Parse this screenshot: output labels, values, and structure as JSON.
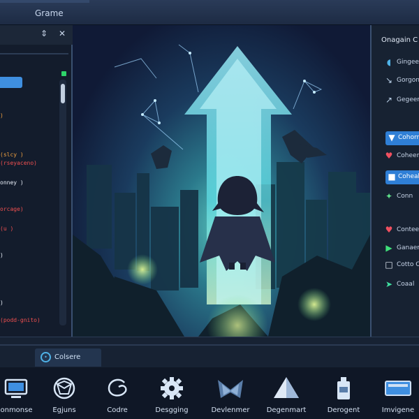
{
  "window": {
    "title": "Grame"
  },
  "left_panel": {
    "code_lines": [
      {
        "text": ")",
        "color": "orange"
      },
      {
        "text": "(slcy )",
        "color": "orange"
      },
      {
        "text": "(rseyaceno)",
        "color": "red"
      },
      {
        "text": "onney )",
        "color": "white"
      },
      {
        "text": "orcage)",
        "color": "red"
      },
      {
        "text": "(u )",
        "color": "red"
      },
      {
        "text": ")",
        "color": "white"
      },
      {
        "text": ")",
        "color": "white"
      },
      {
        "text": "(podd-gnito)",
        "color": "red"
      }
    ]
  },
  "right_panel": {
    "title": "Onagain C",
    "items": [
      {
        "label": "Gingeed",
        "icon": "cursor-icon",
        "selected": false
      },
      {
        "label": "Gorgon",
        "icon": "arrow-icon",
        "selected": false
      },
      {
        "label": "Gegeer",
        "icon": "arrow-icon",
        "selected": false
      },
      {
        "label": "Cohorn",
        "icon": "shield-icon",
        "selected": true
      },
      {
        "label": "Coheen",
        "icon": "heart-icon",
        "selected": false
      },
      {
        "label": "Coheab",
        "icon": "puzzle-icon",
        "selected": true
      },
      {
        "label": "Conn",
        "icon": "star-icon",
        "selected": false
      },
      {
        "label": "Conteel",
        "icon": "heart-icon",
        "selected": false
      },
      {
        "label": "Ganaer",
        "icon": "play-icon",
        "selected": false
      },
      {
        "label": "Cotto Co",
        "icon": "square-icon",
        "selected": false
      },
      {
        "label": "Coaal",
        "icon": "play-icon",
        "selected": false
      }
    ]
  },
  "console_tab": {
    "label": "Colsere"
  },
  "toolbar": {
    "items": [
      {
        "label": "Conmonse",
        "icon": "monitor-icon"
      },
      {
        "label": "Egjuns",
        "icon": "network-icon"
      },
      {
        "label": "Codre",
        "icon": "swirl-icon"
      },
      {
        "label": "Desgging",
        "icon": "gear-icon"
      },
      {
        "label": "Devlenmer",
        "icon": "wing-icon"
      },
      {
        "label": "Degenmart",
        "icon": "pyramid-icon"
      },
      {
        "label": "Derogent",
        "icon": "bottle-icon"
      },
      {
        "label": "Imvigene",
        "icon": "window-icon"
      }
    ]
  },
  "colors": {
    "accent": "#2f7fd6",
    "panel": "#172232",
    "background": "#0e1626",
    "beam": "#57d8f0"
  }
}
